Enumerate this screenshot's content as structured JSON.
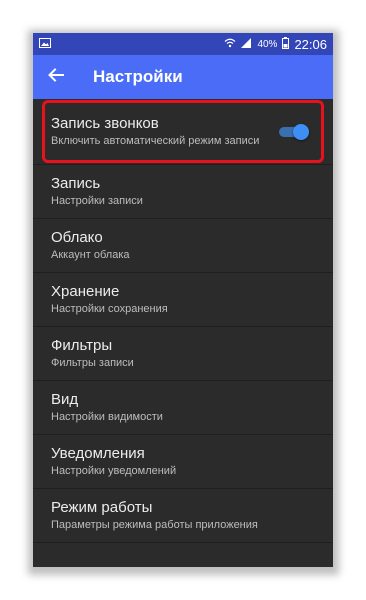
{
  "status_bar": {
    "battery_percent": "40%",
    "time": "22:06",
    "icons": [
      "image-icon",
      "wifi-icon",
      "signal-icon",
      "battery-icon"
    ]
  },
  "app_bar": {
    "title": "Настройки",
    "back_icon": "arrow-back-icon"
  },
  "settings": {
    "items": [
      {
        "title": "Запись звонков",
        "subtitle": "Включить автоматический режим записи",
        "toggle": true
      },
      {
        "title": "Запись",
        "subtitle": "Настройки записи"
      },
      {
        "title": "Облако",
        "subtitle": "Аккаунт облака"
      },
      {
        "title": "Хранение",
        "subtitle": "Настройки сохранения"
      },
      {
        "title": "Фильтры",
        "subtitle": "Фильтры записи"
      },
      {
        "title": "Вид",
        "subtitle": "Настройки видимости"
      },
      {
        "title": "Уведомления",
        "subtitle": "Настройки уведомлений"
      },
      {
        "title": "Режим работы",
        "subtitle": "Параметры режима работы приложения"
      }
    ]
  },
  "colors": {
    "status_bar": "#3346b8",
    "app_bar": "#4a6cf7",
    "background": "#2b2b2b",
    "toggle_accent": "#3d8ff5",
    "highlight": "#e8121c"
  }
}
